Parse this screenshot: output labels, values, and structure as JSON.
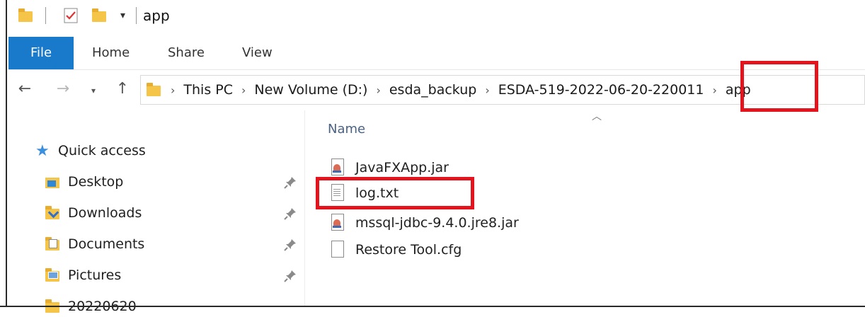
{
  "window": {
    "title": "app"
  },
  "quick_access_toolbar": {
    "items": [
      "folder-icon",
      "properties-check-icon",
      "new-folder-icon",
      "customize-dropdown"
    ]
  },
  "ribbon": {
    "tabs": [
      {
        "label": "File",
        "active": true
      },
      {
        "label": "Home"
      },
      {
        "label": "Share"
      },
      {
        "label": "View"
      }
    ]
  },
  "address_bar": {
    "breadcrumbs": [
      "This PC",
      "New Volume (D:)",
      "esda_backup",
      "ESDA-519-2022-06-20-220011",
      "app"
    ]
  },
  "nav_pane": {
    "quick_access_label": "Quick access",
    "items": [
      {
        "label": "Desktop",
        "pinned": true
      },
      {
        "label": "Downloads",
        "pinned": true
      },
      {
        "label": "Documents",
        "pinned": true
      },
      {
        "label": "Pictures",
        "pinned": true
      },
      {
        "label": "20220620",
        "pinned": false
      }
    ]
  },
  "file_list": {
    "column_header": "Name",
    "files": [
      {
        "name": "JavaFXApp.jar",
        "icon": "jar-file-icon"
      },
      {
        "name": "log.txt",
        "icon": "text-file-icon"
      },
      {
        "name": "mssql-jdbc-9.4.0.jre8.jar",
        "icon": "jar-file-icon"
      },
      {
        "name": "Restore Tool.cfg",
        "icon": "file-icon"
      }
    ]
  },
  "colors": {
    "file_tab": "#1979ca",
    "highlight": "#e3141d",
    "column_header": "#4a6283",
    "star": "#3b8fdc"
  }
}
